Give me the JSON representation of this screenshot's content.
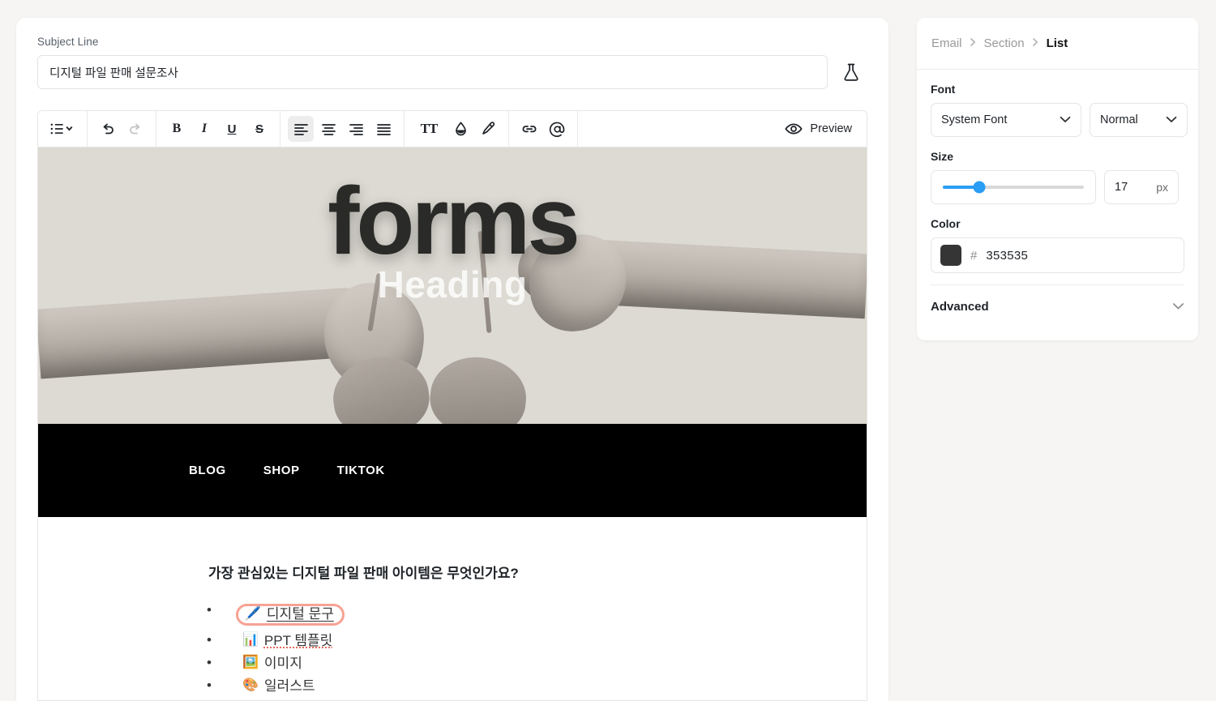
{
  "editor": {
    "subject": {
      "label": "Subject Line",
      "value": "디지털 파일 판매 설문조사",
      "placeholder": "Subject Line",
      "ab_test_icon": "flask-icon"
    },
    "toolbar": {
      "list_icon": "bullet-list-icon",
      "list_chevron_icon": "chevron-down-icon",
      "undo_icon": "undo-icon",
      "redo_icon": "redo-icon",
      "bold_label": "B",
      "italic_label": "I",
      "underline_label": "U",
      "strikethrough_label": "S",
      "align_left_icon": "align-left-icon",
      "align_center_icon": "align-center-icon",
      "align_right_icon": "align-right-icon",
      "align_justify_icon": "align-justify-icon",
      "font_size_label": "TT",
      "text_color_icon": "droplet-icon",
      "highlight_icon": "highlighter-pen-icon",
      "link_icon": "link-icon",
      "mention_icon": "at-mention-icon",
      "preview_icon": "eye-icon",
      "preview_label": "Preview"
    }
  },
  "email": {
    "hero": {
      "title": "forms",
      "subtitle": "Heading"
    },
    "nav": [
      {
        "label": "BLOG"
      },
      {
        "label": "SHOP"
      },
      {
        "label": "TIKTOK"
      }
    ],
    "question": "가장 관심있는 디지털 파일 판매 아이템은 무엇인가요?",
    "list_items": [
      {
        "emoji": "🖊️",
        "text": "디지털 문구",
        "selected": true
      },
      {
        "emoji": "📊",
        "text": "PPT 템플릿",
        "selected": false
      },
      {
        "emoji": "🖼️",
        "text": "이미지",
        "selected": false
      },
      {
        "emoji": "🎨",
        "text": "일러스트",
        "selected": false
      }
    ]
  },
  "panel": {
    "breadcrumb": [
      {
        "label": "Email",
        "active": false
      },
      {
        "label": "Section",
        "active": false
      },
      {
        "label": "List",
        "active": true
      }
    ],
    "breadcrumb_separator": "❯",
    "font": {
      "label": "Font",
      "family_value": "System Font",
      "weight_value": "Normal",
      "chevron_icon": "chevron-down-icon"
    },
    "size": {
      "label": "Size",
      "value": "17",
      "unit": "px",
      "percent": 26,
      "accent": "#2a9df4"
    },
    "color": {
      "label": "Color",
      "hash": "#",
      "value": "353535",
      "swatch": "#353535"
    },
    "advanced": {
      "label": "Advanced",
      "chevron_icon": "chevron-down-icon"
    }
  },
  "theme": {
    "page_background": "#f6f5f3",
    "selection_outline": "#f7a294",
    "navbar_background": "#000000"
  }
}
